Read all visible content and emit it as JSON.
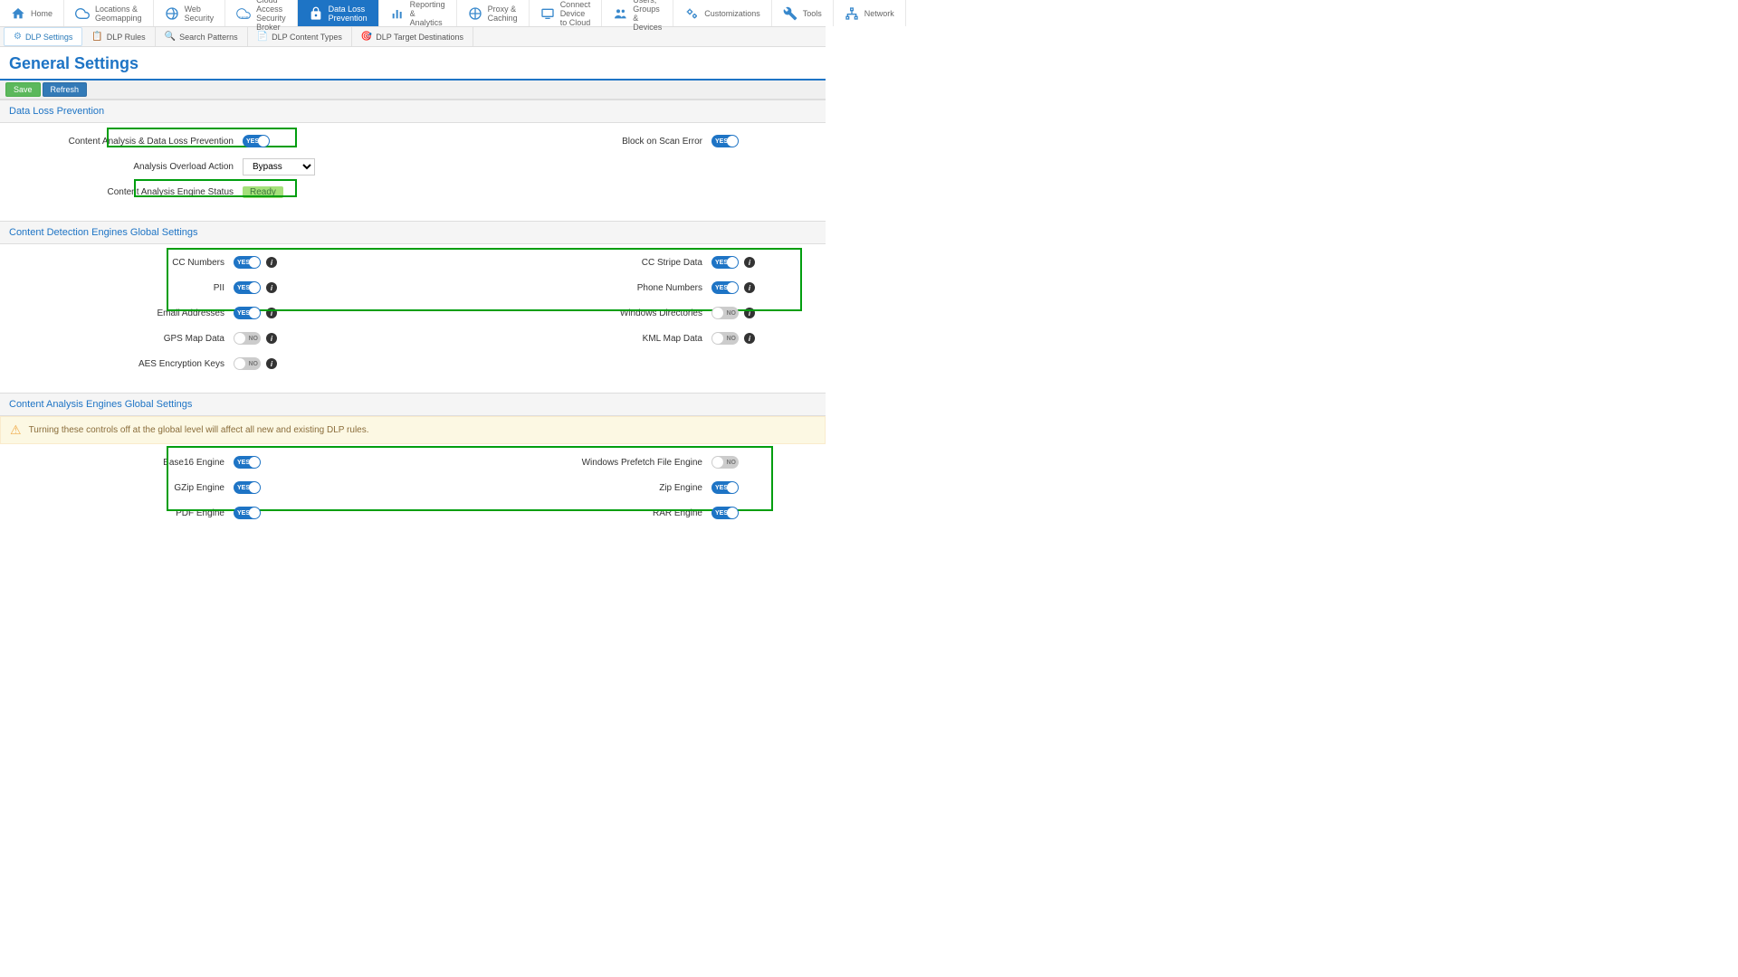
{
  "topnav": [
    {
      "label": "Home",
      "icon": "home"
    },
    {
      "label": "Locations &\nGeomapping",
      "icon": "cloud"
    },
    {
      "label": "Web Security",
      "icon": "globe-shield"
    },
    {
      "label": "Cloud Access\nSecurity Broker",
      "icon": "casb"
    },
    {
      "label": "Data Loss\nPrevention",
      "icon": "lock",
      "active": true
    },
    {
      "label": "Reporting &\nAnalytics",
      "icon": "chart"
    },
    {
      "label": "Proxy &\nCaching",
      "icon": "proxy"
    },
    {
      "label": "Connect Device\nto Cloud",
      "icon": "connect"
    },
    {
      "label": "Users, Groups\n& Devices",
      "icon": "users"
    },
    {
      "label": "Customizations",
      "icon": "gears"
    },
    {
      "label": "Tools",
      "icon": "wrench"
    },
    {
      "label": "Network",
      "icon": "network"
    }
  ],
  "subnav": [
    {
      "label": "DLP Settings",
      "active": true
    },
    {
      "label": "DLP Rules"
    },
    {
      "label": "Search Patterns"
    },
    {
      "label": "DLP Content Types"
    },
    {
      "label": "DLP Target Destinations"
    }
  ],
  "page_title": "General Settings",
  "actions": {
    "save": "Save",
    "refresh": "Refresh"
  },
  "sections": {
    "dlp": {
      "title": "Data Loss Prevention",
      "content_analysis_label": "Content Analysis & Data Loss Prevention",
      "content_analysis_on": true,
      "block_on_scan_error_label": "Block on Scan Error",
      "block_on_scan_error_on": true,
      "overload_label": "Analysis Overload Action",
      "overload_value": "Bypass",
      "engine_status_label": "Content Analysis Engine Status",
      "engine_status_value": "Ready"
    },
    "detection": {
      "title": "Content Detection Engines Global Settings",
      "left": [
        {
          "label": "CC Numbers",
          "on": true
        },
        {
          "label": "PII",
          "on": true
        },
        {
          "label": "Email Addresses",
          "on": true
        },
        {
          "label": "GPS Map Data",
          "on": false
        },
        {
          "label": "AES Encryption Keys",
          "on": false
        }
      ],
      "right": [
        {
          "label": "CC Stripe Data",
          "on": true
        },
        {
          "label": "Phone Numbers",
          "on": true
        },
        {
          "label": "Windows Directories",
          "on": false
        },
        {
          "label": "KML Map Data",
          "on": false
        }
      ]
    },
    "analysis": {
      "title": "Content Analysis Engines Global Settings",
      "warning": "Turning these controls off at the global level will affect all new and existing DLP rules.",
      "left": [
        {
          "label": "Base16 Engine",
          "on": true
        },
        {
          "label": "GZip Engine",
          "on": true
        },
        {
          "label": "PDF Engine",
          "on": true
        }
      ],
      "right": [
        {
          "label": "Windows Prefetch File Engine",
          "on": false
        },
        {
          "label": "Zip Engine",
          "on": true
        },
        {
          "label": "RAR Engine",
          "on": true
        }
      ]
    }
  },
  "toggle_text": {
    "yes": "YES",
    "no": "NO"
  }
}
